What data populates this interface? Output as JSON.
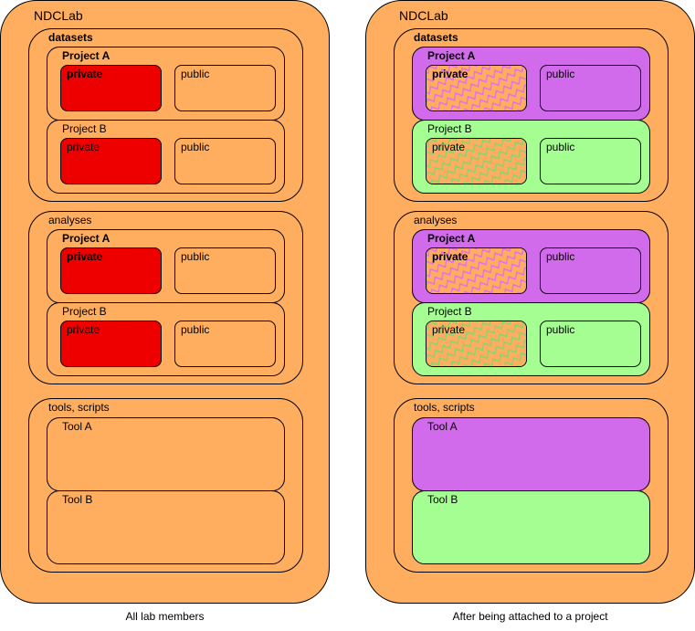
{
  "colors": {
    "lab": "#FFAD5F",
    "restricted": "#EE0000",
    "project_a": "#D26BEB",
    "project_b": "#A5FE91",
    "hatch_project_a": "#E16CF7",
    "hatch_project_b": "#7ED872"
  },
  "diagrams": [
    {
      "title": "NDCLab",
      "caption": "All lab members",
      "datasets": {
        "label": "datasets",
        "projects": [
          {
            "name": "Project A",
            "private": "private",
            "public": "public"
          },
          {
            "name": "Project B",
            "private": "private",
            "public": "public"
          }
        ]
      },
      "analyses": {
        "label": "analyses",
        "projects": [
          {
            "name": "Project A",
            "private": "private",
            "public": "public"
          },
          {
            "name": "Project B",
            "private": "private",
            "public": "public"
          }
        ]
      },
      "tools": {
        "label": "tools, scripts",
        "items": [
          "Tool A",
          "Tool B"
        ]
      }
    },
    {
      "title": "NDCLab",
      "caption": "After being attached to a project",
      "datasets": {
        "label": "datasets",
        "projects": [
          {
            "name": "Project A",
            "private": "private",
            "public": "public"
          },
          {
            "name": "Project B",
            "private": "private",
            "public": "public"
          }
        ]
      },
      "analyses": {
        "label": "analyses",
        "projects": [
          {
            "name": "Project A",
            "private": "private",
            "public": "public"
          },
          {
            "name": "Project B",
            "private": "private",
            "public": "public"
          }
        ]
      },
      "tools": {
        "label": "tools, scripts",
        "items": [
          "Tool A",
          "Tool B"
        ]
      }
    }
  ]
}
